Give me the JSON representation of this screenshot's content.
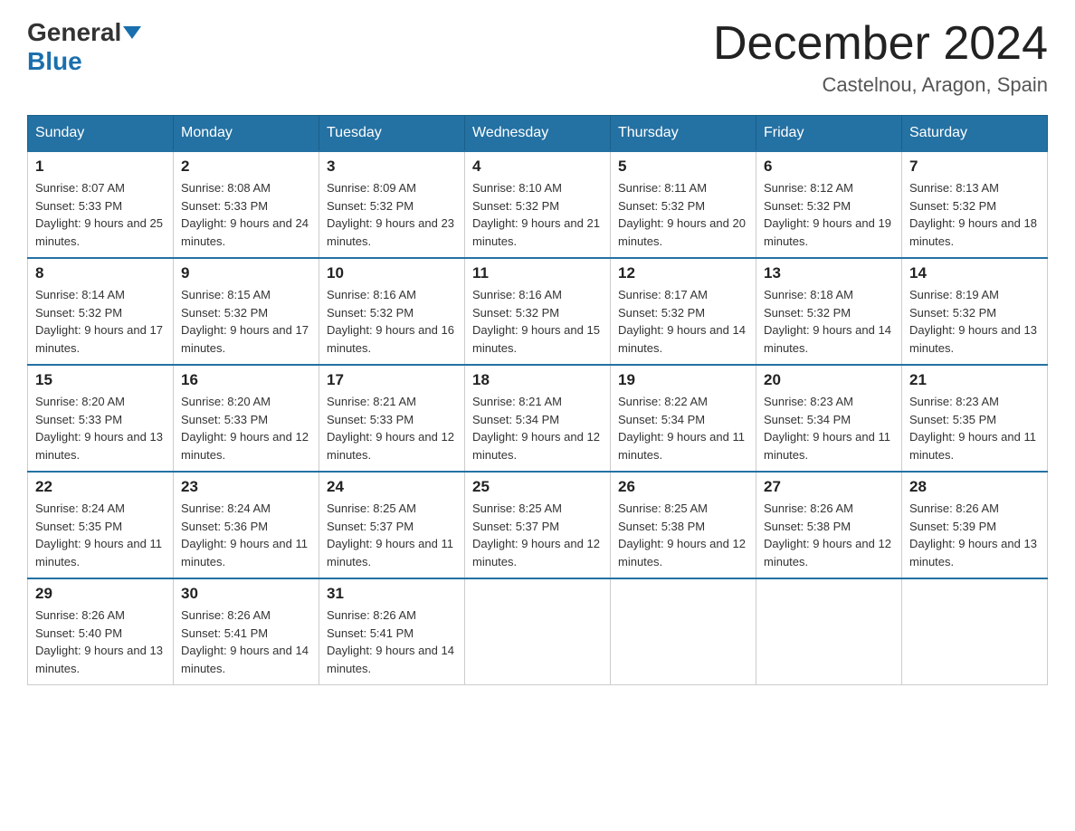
{
  "header": {
    "logo_general": "General",
    "logo_blue": "Blue",
    "month_title": "December 2024",
    "location": "Castelnou, Aragon, Spain"
  },
  "weekdays": [
    "Sunday",
    "Monday",
    "Tuesday",
    "Wednesday",
    "Thursday",
    "Friday",
    "Saturday"
  ],
  "weeks": [
    [
      {
        "day": "1",
        "sunrise": "8:07 AM",
        "sunset": "5:33 PM",
        "daylight": "9 hours and 25 minutes."
      },
      {
        "day": "2",
        "sunrise": "8:08 AM",
        "sunset": "5:33 PM",
        "daylight": "9 hours and 24 minutes."
      },
      {
        "day": "3",
        "sunrise": "8:09 AM",
        "sunset": "5:32 PM",
        "daylight": "9 hours and 23 minutes."
      },
      {
        "day": "4",
        "sunrise": "8:10 AM",
        "sunset": "5:32 PM",
        "daylight": "9 hours and 21 minutes."
      },
      {
        "day": "5",
        "sunrise": "8:11 AM",
        "sunset": "5:32 PM",
        "daylight": "9 hours and 20 minutes."
      },
      {
        "day": "6",
        "sunrise": "8:12 AM",
        "sunset": "5:32 PM",
        "daylight": "9 hours and 19 minutes."
      },
      {
        "day": "7",
        "sunrise": "8:13 AM",
        "sunset": "5:32 PM",
        "daylight": "9 hours and 18 minutes."
      }
    ],
    [
      {
        "day": "8",
        "sunrise": "8:14 AM",
        "sunset": "5:32 PM",
        "daylight": "9 hours and 17 minutes."
      },
      {
        "day": "9",
        "sunrise": "8:15 AM",
        "sunset": "5:32 PM",
        "daylight": "9 hours and 17 minutes."
      },
      {
        "day": "10",
        "sunrise": "8:16 AM",
        "sunset": "5:32 PM",
        "daylight": "9 hours and 16 minutes."
      },
      {
        "day": "11",
        "sunrise": "8:16 AM",
        "sunset": "5:32 PM",
        "daylight": "9 hours and 15 minutes."
      },
      {
        "day": "12",
        "sunrise": "8:17 AM",
        "sunset": "5:32 PM",
        "daylight": "9 hours and 14 minutes."
      },
      {
        "day": "13",
        "sunrise": "8:18 AM",
        "sunset": "5:32 PM",
        "daylight": "9 hours and 14 minutes."
      },
      {
        "day": "14",
        "sunrise": "8:19 AM",
        "sunset": "5:32 PM",
        "daylight": "9 hours and 13 minutes."
      }
    ],
    [
      {
        "day": "15",
        "sunrise": "8:20 AM",
        "sunset": "5:33 PM",
        "daylight": "9 hours and 13 minutes."
      },
      {
        "day": "16",
        "sunrise": "8:20 AM",
        "sunset": "5:33 PM",
        "daylight": "9 hours and 12 minutes."
      },
      {
        "day": "17",
        "sunrise": "8:21 AM",
        "sunset": "5:33 PM",
        "daylight": "9 hours and 12 minutes."
      },
      {
        "day": "18",
        "sunrise": "8:21 AM",
        "sunset": "5:34 PM",
        "daylight": "9 hours and 12 minutes."
      },
      {
        "day": "19",
        "sunrise": "8:22 AM",
        "sunset": "5:34 PM",
        "daylight": "9 hours and 11 minutes."
      },
      {
        "day": "20",
        "sunrise": "8:23 AM",
        "sunset": "5:34 PM",
        "daylight": "9 hours and 11 minutes."
      },
      {
        "day": "21",
        "sunrise": "8:23 AM",
        "sunset": "5:35 PM",
        "daylight": "9 hours and 11 minutes."
      }
    ],
    [
      {
        "day": "22",
        "sunrise": "8:24 AM",
        "sunset": "5:35 PM",
        "daylight": "9 hours and 11 minutes."
      },
      {
        "day": "23",
        "sunrise": "8:24 AM",
        "sunset": "5:36 PM",
        "daylight": "9 hours and 11 minutes."
      },
      {
        "day": "24",
        "sunrise": "8:25 AM",
        "sunset": "5:37 PM",
        "daylight": "9 hours and 11 minutes."
      },
      {
        "day": "25",
        "sunrise": "8:25 AM",
        "sunset": "5:37 PM",
        "daylight": "9 hours and 12 minutes."
      },
      {
        "day": "26",
        "sunrise": "8:25 AM",
        "sunset": "5:38 PM",
        "daylight": "9 hours and 12 minutes."
      },
      {
        "day": "27",
        "sunrise": "8:26 AM",
        "sunset": "5:38 PM",
        "daylight": "9 hours and 12 minutes."
      },
      {
        "day": "28",
        "sunrise": "8:26 AM",
        "sunset": "5:39 PM",
        "daylight": "9 hours and 13 minutes."
      }
    ],
    [
      {
        "day": "29",
        "sunrise": "8:26 AM",
        "sunset": "5:40 PM",
        "daylight": "9 hours and 13 minutes."
      },
      {
        "day": "30",
        "sunrise": "8:26 AM",
        "sunset": "5:41 PM",
        "daylight": "9 hours and 14 minutes."
      },
      {
        "day": "31",
        "sunrise": "8:26 AM",
        "sunset": "5:41 PM",
        "daylight": "9 hours and 14 minutes."
      },
      null,
      null,
      null,
      null
    ]
  ]
}
